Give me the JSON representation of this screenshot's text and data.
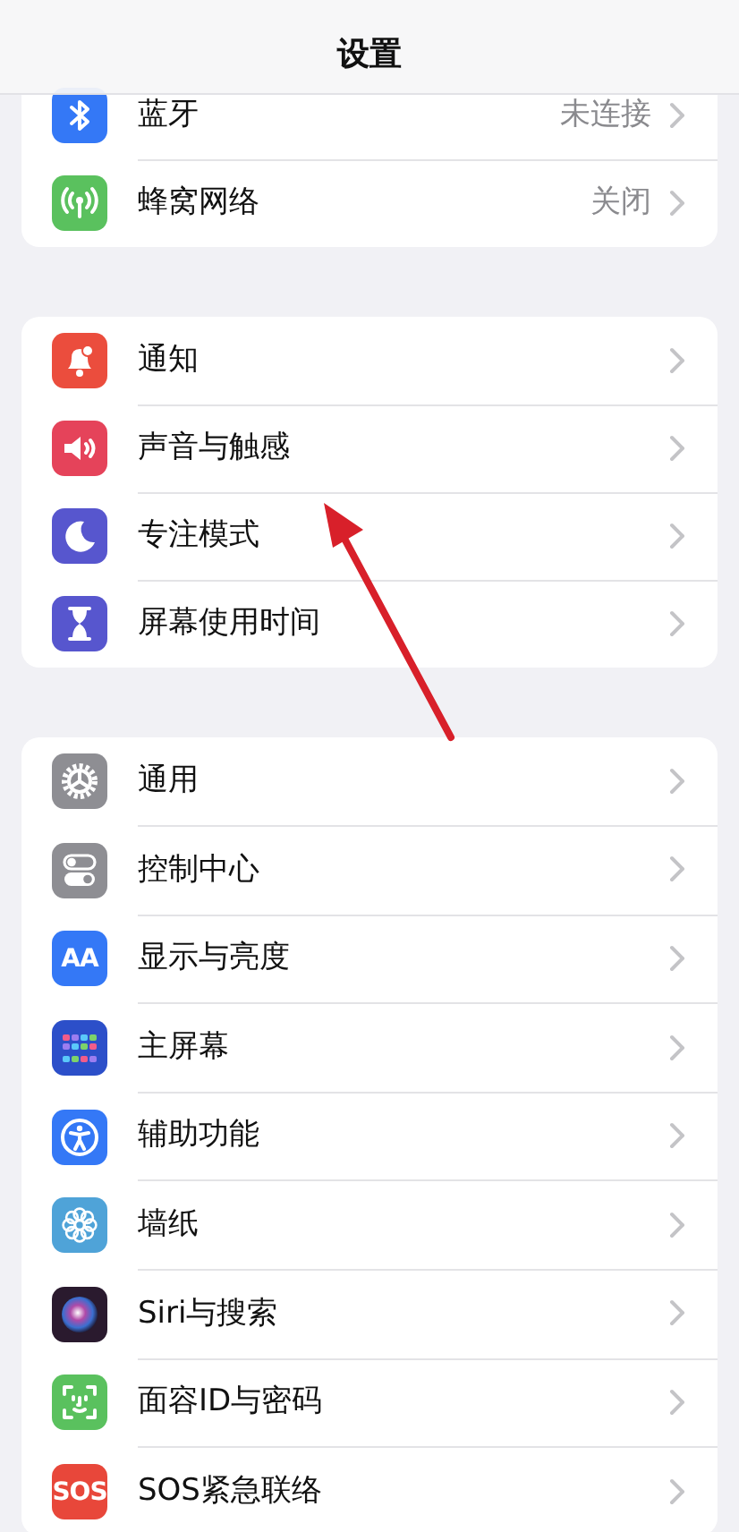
{
  "nav_bar": {
    "title": "设置"
  },
  "groups": [
    {
      "items": [
        {
          "color": "#3478f6",
          "label": "蓝牙",
          "value": "未连接"
        },
        {
          "color": "#5ac15e",
          "label": "蜂窝网络",
          "value": "关闭"
        }
      ]
    },
    {
      "items": [
        {
          "color": "#eb4d3d",
          "label": "通知"
        },
        {
          "color": "#e5435a",
          "label": "声音与触感"
        },
        {
          "color": "#5756ce",
          "label": "专注模式"
        },
        {
          "color": "#5756ce",
          "label": "屏幕使用时间"
        }
      ]
    },
    {
      "items": [
        {
          "color": "#8e8e93",
          "label": "通用"
        },
        {
          "color": "#8e8e93",
          "label": "控制中心"
        },
        {
          "color": "#3478f6",
          "icon_text": "AA",
          "label": "显示与亮度"
        },
        {
          "color": "#2c4fc9",
          "label": "主屏幕"
        },
        {
          "color": "#3478f6",
          "label": "辅助功能"
        },
        {
          "color": "#4fa3d8",
          "label": "墙纸"
        },
        {
          "color": "#2a1a2e",
          "label": "Siri与搜索"
        },
        {
          "color": "#5ac15e",
          "label": "面容ID与密码"
        },
        {
          "color": "#e8473a",
          "icon_text": "SOS",
          "label": "SOS紧急联络"
        }
      ]
    }
  ],
  "annotation": {
    "kind": "arrow"
  }
}
